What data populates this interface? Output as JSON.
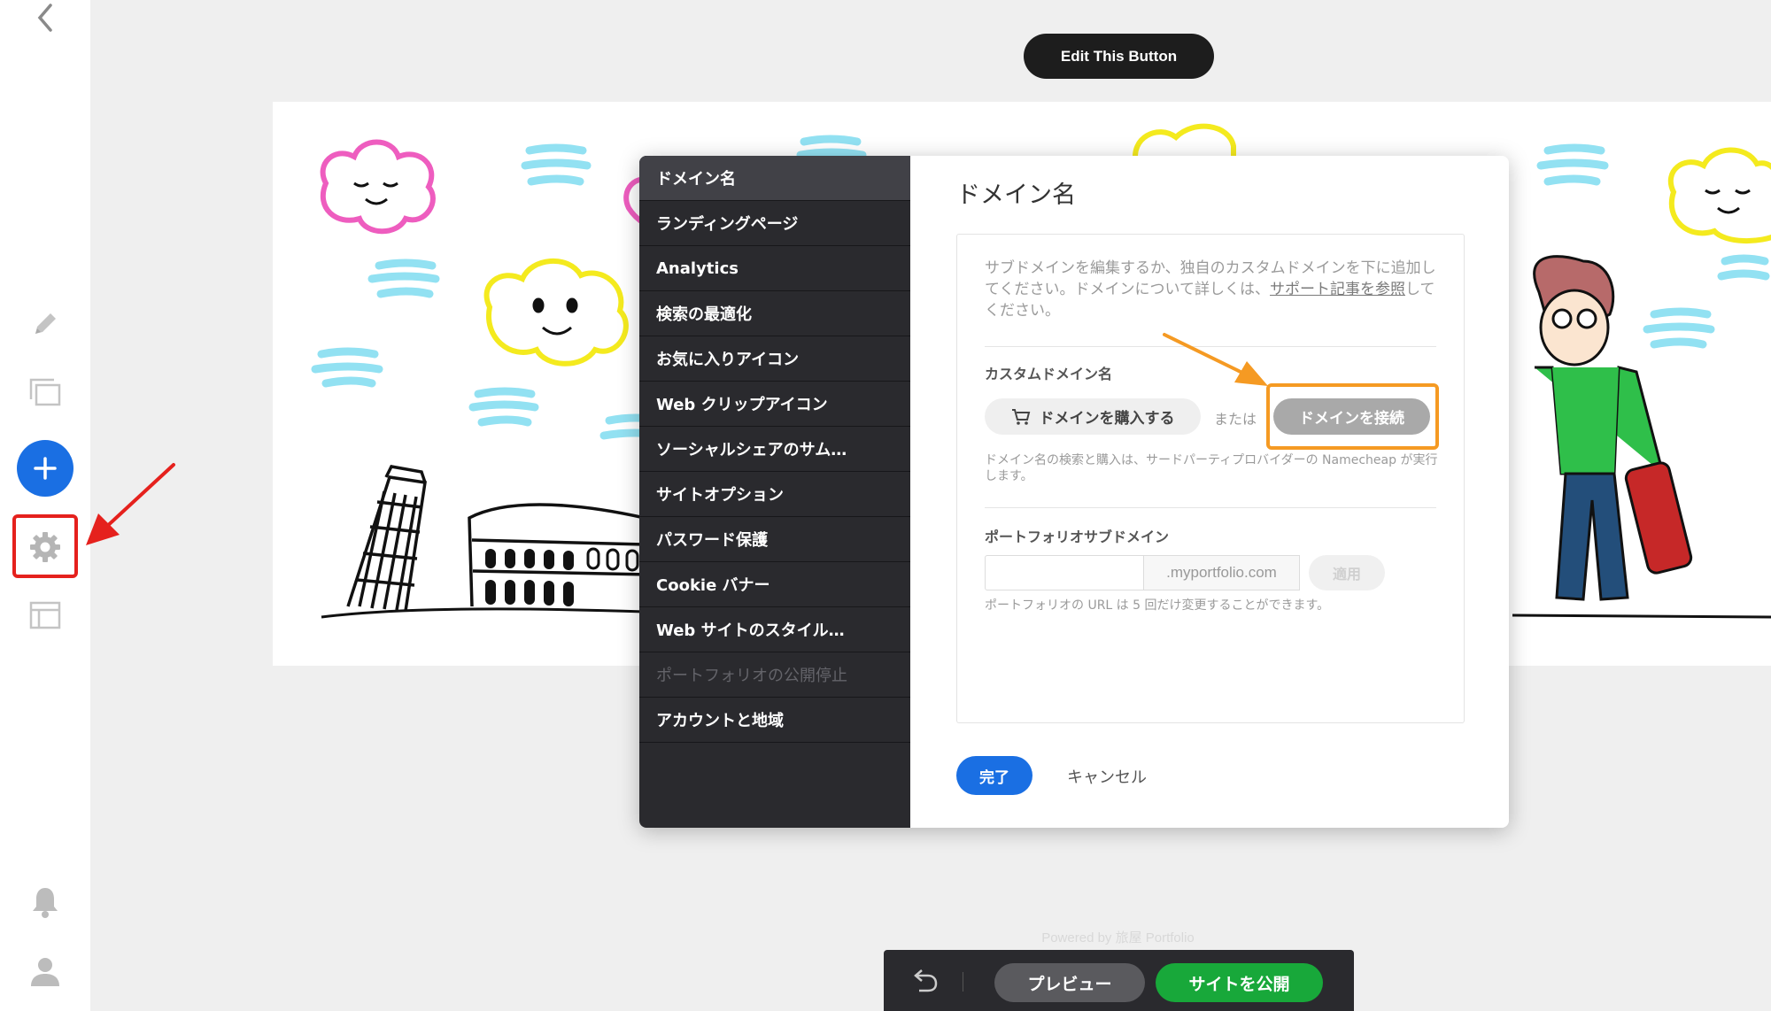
{
  "top": {
    "edit_button": "Edit This Button"
  },
  "powered_by": "Powered by 旅屋 Portfolio",
  "menu": [
    {
      "label": "ドメイン名",
      "state": "active"
    },
    {
      "label": "ランディングページ",
      "state": "normal"
    },
    {
      "label": "Analytics",
      "state": "normal"
    },
    {
      "label": "検索の最適化",
      "state": "normal"
    },
    {
      "label": "お気に入りアイコン",
      "state": "normal"
    },
    {
      "label": "Web クリップアイコン",
      "state": "normal"
    },
    {
      "label": "ソーシャルシェアのサム…",
      "state": "normal"
    },
    {
      "label": "サイトオプション",
      "state": "normal"
    },
    {
      "label": "パスワード保護",
      "state": "normal"
    },
    {
      "label": "Cookie バナー",
      "state": "normal"
    },
    {
      "label": "Web サイトのスタイル…",
      "state": "normal"
    },
    {
      "label": "ポートフォリオの公開停止",
      "state": "disabled"
    },
    {
      "label": "アカウントと地域",
      "state": "normal"
    }
  ],
  "content": {
    "title": "ドメイン名",
    "description_part1": "サブドメインを編集するか、独自のカスタムドメインを下に追加してください。ドメインについて詳しくは、",
    "description_link": "サポート記事を参照",
    "description_part2": "してください。",
    "custom_domain_label": "カスタムドメイン名",
    "buy_domain_button": "ドメインを購入する",
    "or_text": "または",
    "connect_domain_button": "ドメインを接続",
    "namecheap_note": "ドメイン名の検索と購入は、サードパーティプロバイダーの Namecheap が実行します。",
    "subdomain_label": "ポートフォリオサブドメイン",
    "subdomain_value": "",
    "subdomain_suffix": ".myportfolio.com",
    "apply_button": "適用",
    "subdomain_note": "ポートフォリオの URL は 5 回だけ変更することができます。",
    "done_button": "完了",
    "cancel_button": "キャンセル"
  },
  "bottom_bar": {
    "preview_button": "プレビュー",
    "publish_button": "サイトを公開"
  },
  "colors": {
    "accent_blue": "#1a6fe3",
    "publish_green": "#18a83a",
    "highlight_red": "#e5211d",
    "highlight_orange": "#f59a23",
    "menu_bg": "#2a2a2e"
  }
}
